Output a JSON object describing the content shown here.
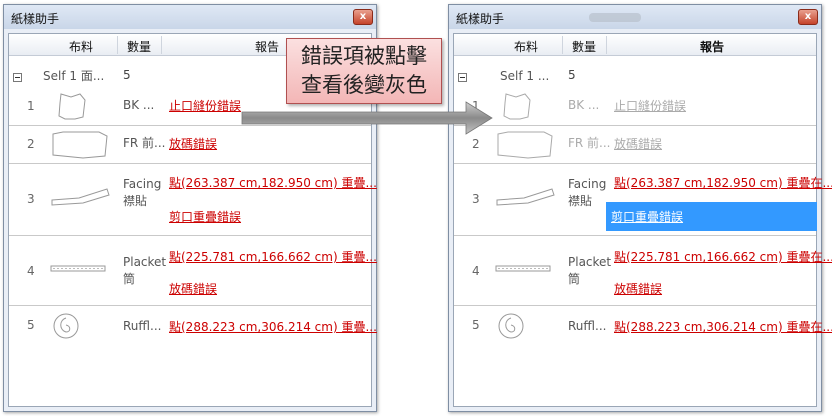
{
  "window_title": "紙樣助手",
  "close_glyph": "x",
  "columns": {
    "fabric": "布料",
    "qty": "數量",
    "report": "報告"
  },
  "callout": {
    "line1": "錯誤項被點擊",
    "line2": "查看後變灰色"
  },
  "group": {
    "name": "Self 1 面...",
    "name_right": "Self 1 ...",
    "qty": "5"
  },
  "rows": [
    {
      "num": "1",
      "name": "BK ...",
      "reports": [
        "止口縫份錯誤"
      ]
    },
    {
      "num": "2",
      "name": "FR 前...",
      "reports": [
        "放碼錯誤"
      ]
    },
    {
      "num": "3",
      "name_line1": "Facing",
      "name_line2": "襟貼",
      "reports_left": [
        "點(263.387 cm,182.950 cm) 重疊...",
        "剪口重疊錯誤"
      ],
      "reports_right": [
        "點(263.387 cm,182.950 cm) 重疊在..."
      ]
    },
    {
      "num": "4",
      "name_line1": "Placket",
      "name_line2": "筒",
      "reports_left": [
        "點(225.781 cm,166.662 cm) 重疊...",
        "放碼錯誤"
      ],
      "reports_right": [
        "點(225.781 cm,166.662 cm) 重疊在..."
      ]
    },
    {
      "num": "5",
      "name": "Ruffl...",
      "reports_left": [
        "點(288.223 cm,306.214 cm) 重疊..."
      ],
      "reports_right": [
        "點(288.223 cm,306.214 cm) 重疊在..."
      ]
    }
  ],
  "colors": {
    "error_link": "#cc0000",
    "viewed_link": "#aaaaaa",
    "selection": "#3399ff",
    "callout_fill": "#f6c4c4"
  }
}
